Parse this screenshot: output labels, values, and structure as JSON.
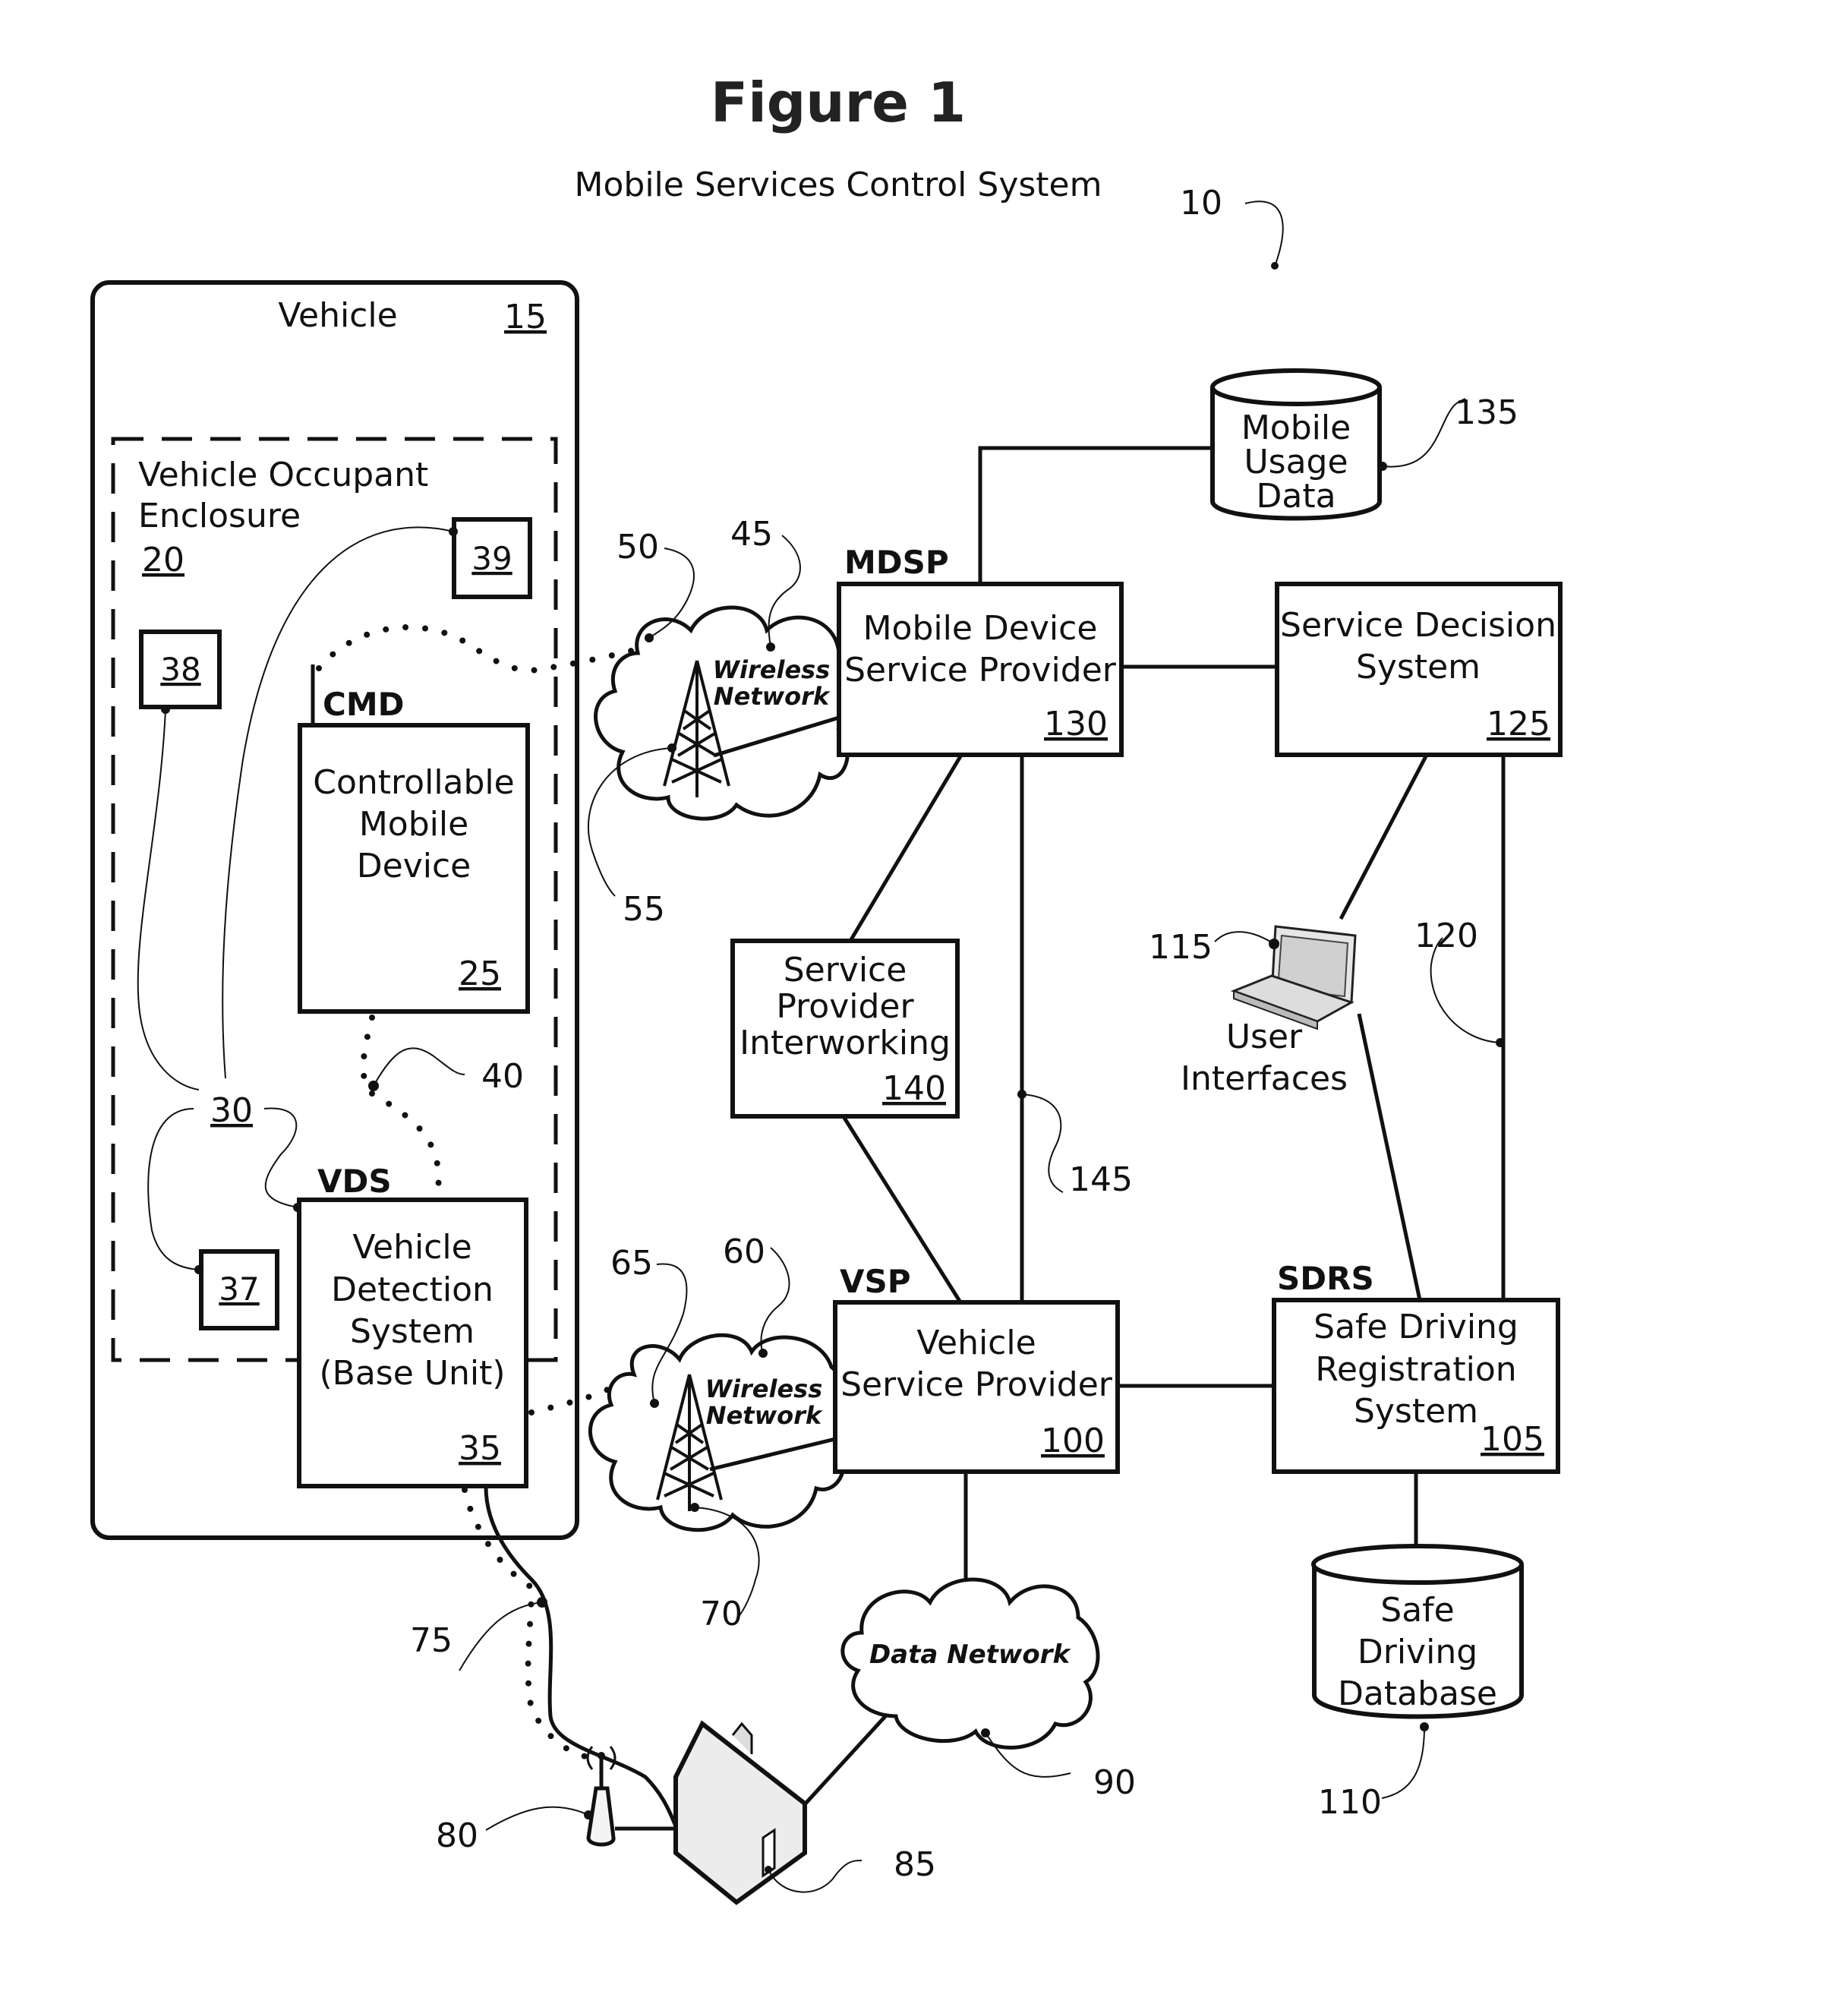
{
  "figure": {
    "title": "Figure 1",
    "subtitle": "Mobile Services Control System",
    "ref": "10"
  },
  "vehicle": {
    "label": "Vehicle",
    "ref": "15",
    "enclosure": {
      "label_line1": "Vehicle Occupant",
      "label_line2": "Enclosure",
      "ref": "20"
    },
    "sensors": [
      {
        "ref": "39"
      },
      {
        "ref": "38"
      },
      {
        "ref": "37"
      }
    ],
    "sensor_group_ref": "30",
    "cmd": {
      "tag": "CMD",
      "lines": [
        "Controllable",
        "Mobile",
        "Device"
      ],
      "ref": "25"
    },
    "vds": {
      "tag": "VDS",
      "lines": [
        "Vehicle",
        "Detection",
        "System",
        "(Base Unit)"
      ],
      "ref": "35"
    },
    "link_cmd_vds_ref": "40"
  },
  "wireless_networks": [
    {
      "line1": "Wireless",
      "line2": "Network",
      "ref_cloud": "45",
      "ref_link": "50",
      "ref_tower": "55"
    },
    {
      "line1": "Wireless",
      "line2": "Network",
      "ref_cloud": "60",
      "ref_link": "65",
      "ref_tower": "70"
    }
  ],
  "home": {
    "link_ref": "75",
    "router_ref": "80",
    "house_ref": "85"
  },
  "data_network": {
    "label": "Data Network",
    "ref": "90"
  },
  "mdsp": {
    "tag": "MDSP",
    "line1": "Mobile Device",
    "line2": "Service Provider",
    "ref": "130"
  },
  "mobile_usage_data": {
    "lines": [
      "Mobile",
      "Usage",
      "Data"
    ],
    "ref": "135"
  },
  "service_decision": {
    "line1": "Service Decision",
    "line2": "System",
    "ref": "125"
  },
  "interworking": {
    "lines": [
      "Service",
      "Provider",
      "Interworking"
    ],
    "ref": "140",
    "link_ref": "145"
  },
  "user_interfaces": {
    "line1": "User",
    "line2": "Interfaces",
    "ref": "115",
    "link_ref": "120"
  },
  "vsp": {
    "tag": "VSP",
    "line1": "Vehicle",
    "line2": "Service Provider",
    "ref": "100"
  },
  "sdrs": {
    "tag": "SDRS",
    "lines": [
      "Safe Driving",
      "Registration",
      "System"
    ],
    "ref": "105"
  },
  "safe_driving_db": {
    "lines": [
      "Safe",
      "Driving",
      "Database"
    ],
    "ref": "110"
  }
}
